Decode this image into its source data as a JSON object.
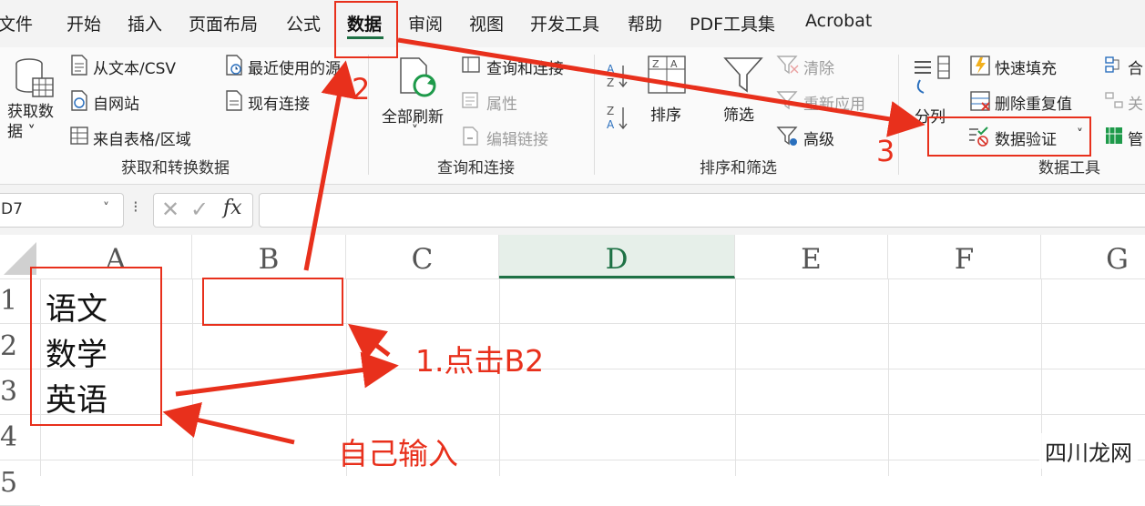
{
  "menu": {
    "tabs": [
      "文件",
      "开始",
      "插入",
      "页面布局",
      "公式",
      "数据",
      "审阅",
      "视图",
      "开发工具",
      "帮助",
      "PDF工具集",
      "Acrobat"
    ],
    "active": "数据"
  },
  "ribbon": {
    "get_data": {
      "big_button": "获取数\n据 ˅",
      "items": [
        "从文本/CSV",
        "自网站",
        "来自表格/区域",
        "最近使用的源",
        "现有连接"
      ],
      "group_label": "获取和转换数据"
    },
    "queries": {
      "refresh_all": "全部刷新",
      "items": [
        "查询和连接",
        "属性",
        "编辑链接"
      ],
      "group_label": "查询和连接"
    },
    "sort_filter": {
      "sort": "排序",
      "filter": "筛选",
      "items": [
        "清除",
        "重新应用",
        "高级"
      ],
      "group_label": "排序和筛选"
    },
    "data_tools": {
      "split": "分列",
      "items": [
        "快速填充",
        "删除重复值",
        "数据验证"
      ],
      "group_label": "数据工具",
      "extra": [
        "合",
        "关",
        "管"
      ]
    }
  },
  "formula_bar": {
    "name_box": "D7",
    "fx": "fx",
    "content": ""
  },
  "grid": {
    "columns": [
      "A",
      "B",
      "C",
      "D",
      "E",
      "F",
      "G"
    ],
    "selected_column": "D",
    "rows": [
      "1",
      "2",
      "3",
      "4",
      "5"
    ],
    "cells": {
      "A1": "语文",
      "A2": "数学",
      "A3": "英语"
    }
  },
  "annotations": {
    "step1": "1.点击B2",
    "step2": "2",
    "step3": "3",
    "note": "自己输入",
    "color": "#e8301c"
  },
  "watermark": "四川龙网",
  "colors": {
    "accent": "#1e7145",
    "annotation": "#e8301c"
  }
}
